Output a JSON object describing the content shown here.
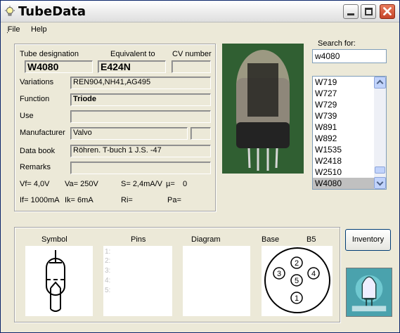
{
  "window": {
    "title": "TubeData"
  },
  "menu": [
    "File",
    "Help"
  ],
  "form": {
    "labels": {
      "tube_designation": "Tube designation",
      "equivalent_to": "Equivalent to",
      "cv_number": "CV number",
      "variations": "Variations",
      "function": "Function",
      "use": "Use",
      "manufacturer": "Manufacturer",
      "data_book": "Data book",
      "remarks": "Remarks"
    },
    "values": {
      "tube_designation": "W4080",
      "equivalent_to": "E424N",
      "cv_number": "",
      "variations": "REN904,NH41,AG495",
      "function": "Triode",
      "use": "",
      "manufacturer": "Valvo",
      "manufacturer_code": "",
      "data_book": "Röhren. T-buch 1 J.S. -47",
      "remarks": ""
    },
    "specs": {
      "vf": "Vf= 4,0V",
      "va": "Va= 250V",
      "s": "S= 2,4mA/V",
      "mu": "µ=",
      "mu_value": "0",
      "if": "If= 1000mA",
      "ik": "Ik= 6mA",
      "ri": "Ri=",
      "pa": "Pa="
    }
  },
  "search": {
    "label": "Search for:",
    "value": "w4080",
    "results": [
      "W719",
      "W727",
      "W729",
      "W739",
      "W891",
      "W892",
      "W1535",
      "W2418",
      "W2510",
      "W4080"
    ],
    "selected": "W4080"
  },
  "bottom": {
    "symbol": "Symbol",
    "pins": "Pins",
    "diagram": "Diagram",
    "base": "Base",
    "base_type": "B5",
    "pin_numbers": [
      "1:",
      "2:",
      "3:",
      "4:",
      "5:"
    ],
    "base_pins": [
      "1",
      "2",
      "3",
      "4",
      "5"
    ]
  },
  "inventory_button": "Inventory",
  "icons": [
    "bulb-icon",
    "minimize-icon",
    "maximize-icon",
    "close-icon",
    "tube-photo",
    "tube-symbol",
    "base-diagram-icon",
    "app-logo"
  ],
  "colors": {
    "titlebar": "#ffffff",
    "selected_row": "#c0c0c0",
    "logo": "#3d8e9a"
  }
}
